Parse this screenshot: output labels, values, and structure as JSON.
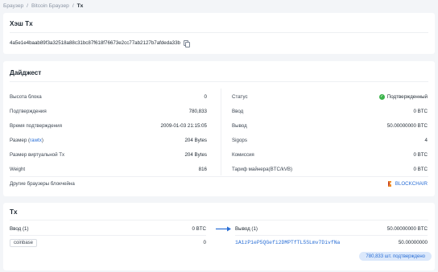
{
  "breadcrumb": {
    "items": [
      "Браузер",
      "Bitcoin Браузер",
      "Tx"
    ],
    "sep": "/"
  },
  "hash_card": {
    "title": "Хэш Tx",
    "hash": "4a5e1e4baab89f3a32518a88c31bc87f618f76673e2cc77ab2127b7afdeda33b"
  },
  "digest": {
    "title": "Дайджест",
    "left": [
      {
        "label": "Высота блока",
        "value": "0"
      },
      {
        "label": "Подтверждения",
        "value": "780,833"
      },
      {
        "label": "Время подтверждения",
        "value": "2009-01-03 21:15:05"
      },
      {
        "label": "Размер",
        "label_link": "rawtx",
        "value": "204 Bytes"
      },
      {
        "label": "Размер виртуальной Tx",
        "value": "204 Bytes"
      },
      {
        "label": "Weight",
        "value": "816"
      }
    ],
    "right": [
      {
        "label": "Статус",
        "value": "Подтвержденный"
      },
      {
        "label": "Ввод",
        "value": "0 BTC"
      },
      {
        "label": "Вывод",
        "value": "50.00000000 BTC"
      },
      {
        "label": "Sigops",
        "value": "4"
      },
      {
        "label": "Комиссия",
        "value": "0 BTC"
      },
      {
        "label": "Тариф майнера(BTC/kVB)",
        "value": "0 BTC"
      }
    ],
    "other_label": "Другие браузеры блокчейна",
    "other_link": "BLOCKCHAIR"
  },
  "tx": {
    "title": "Tx",
    "input_header": "Ввод (1)",
    "input_total": "0 BTC",
    "output_header": "Вывод (1)",
    "output_total": "50.00000000 BTC",
    "input_source": "coinbase",
    "input_value": "0",
    "output_address": "1A1zP1eP5QGefi2DMPTfTL5SLmv7DivfNa",
    "output_value": "50.00000000",
    "confirmations": "780,833 шт. подтверждено"
  },
  "colors": {
    "accent": "#2a6fd6",
    "success": "#3cb44b",
    "chip": "#dbe8fb"
  }
}
